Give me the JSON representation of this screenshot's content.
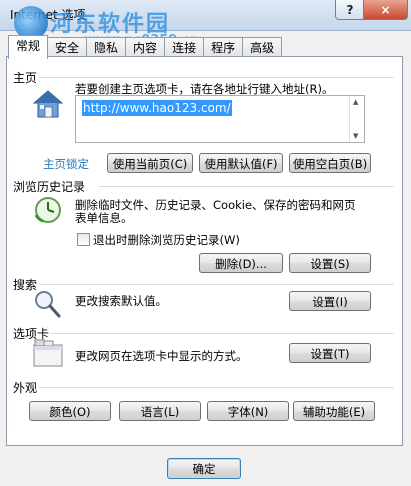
{
  "window": {
    "title": "Internet 选项",
    "help_glyph": "?",
    "close_glyph": "×"
  },
  "watermark": {
    "site_name": "河东软件园",
    "url": "www.pc0359.cn"
  },
  "tabs": [
    {
      "label": "常规",
      "active": true
    },
    {
      "label": "安全",
      "active": false
    },
    {
      "label": "隐私",
      "active": false
    },
    {
      "label": "内容",
      "active": false
    },
    {
      "label": "连接",
      "active": false
    },
    {
      "label": "程序",
      "active": false
    },
    {
      "label": "高级",
      "active": false
    }
  ],
  "home": {
    "section_label": "主页",
    "description": "若要创建主页选项卡，请在各地址行键入地址(R)。",
    "url_value": "http://www.hao123.com/",
    "locked_label": "主页锁定",
    "use_current_label": "使用当前页(C)",
    "use_default_label": "使用默认值(F)",
    "use_blank_label": "使用空白页(B)"
  },
  "history": {
    "section_label": "浏览历史记录",
    "description_line1": "删除临时文件、历史记录、Cookie、保存的密码和网页",
    "description_line2": "表单信息。",
    "delete_on_exit_label": "退出时删除浏览历史记录(W)",
    "delete_on_exit_checked": false,
    "delete_button_label": "删除(D)...",
    "settings_button_label": "设置(S)"
  },
  "search": {
    "section_label": "搜索",
    "description": "更改搜索默认值。",
    "settings_button_label": "设置(I)"
  },
  "tabs_section": {
    "section_label": "选项卡",
    "description": "更改网页在选项卡中显示的方式。",
    "settings_button_label": "设置(T)"
  },
  "appearance": {
    "section_label": "外观",
    "colors_label": "颜色(O)",
    "languages_label": "语言(L)",
    "fonts_label": "字体(N)",
    "accessibility_label": "辅助功能(E)"
  },
  "footer": {
    "ok_label": "确定"
  }
}
